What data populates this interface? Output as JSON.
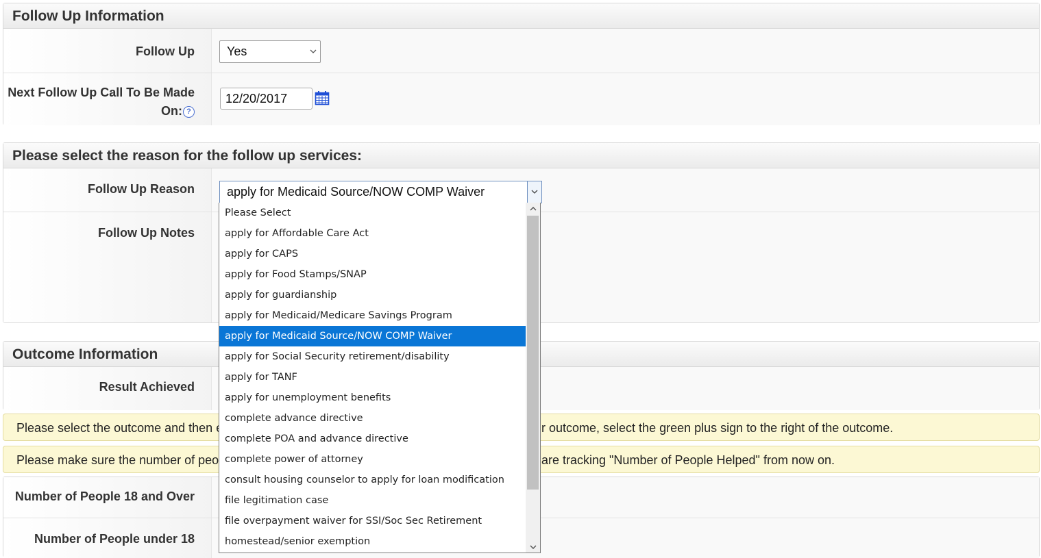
{
  "follow_up_panel": {
    "title": "Follow Up Information",
    "follow_up_label": "Follow Up",
    "follow_up_value": "Yes",
    "next_call_label": "Next Follow Up Call To Be Made On:",
    "next_call_value": "12/20/2017",
    "help_glyph": "?"
  },
  "reason_panel": {
    "title": "Please select the reason for the follow up services:",
    "reason_label": "Follow Up Reason",
    "reason_value": "apply for Medicaid Source/NOW COMP Waiver",
    "notes_label": "Follow Up Notes"
  },
  "outcome_panel": {
    "title": "Outcome Information",
    "result_label": "Result Achieved"
  },
  "notices": [
    {
      "left": "Please select the outcome and then er",
      "right": "r outcome, select the green plus sign to the right of the outcome."
    },
    {
      "left": "Please make sure the number of peop",
      "right": "are tracking \"Number of People Helped\" from now on."
    }
  ],
  "people_rows": [
    {
      "label": "Number of People 18 and Over"
    },
    {
      "label": "Number of People under 18"
    }
  ],
  "dropdown": {
    "selected": "apply for Medicaid Source/NOW COMP Waiver",
    "options": [
      "Please Select",
      "apply for Affordable Care Act",
      "apply for CAPS",
      "apply for Food Stamps/SNAP",
      "apply for guardianship",
      "apply for Medicaid/Medicare Savings Program",
      "apply for Medicaid Source/NOW COMP Waiver",
      "apply for Social Security retirement/disability",
      "apply for TANF",
      "apply for unemployment benefits",
      "complete advance directive",
      "complete POA and advance directive",
      "complete power of attorney",
      "consult housing counselor to apply for loan modification",
      "file legitimation case",
      "file overpayment waiver for SSI/Soc Sec Retirement",
      "homestead/senior exemption"
    ]
  },
  "icons": {
    "calendar": "calendar-icon",
    "help": "help-icon",
    "chevron": "chevron-down-icon"
  },
  "colors": {
    "selected_option": "#0a76d6",
    "notice_bg": "#fcf8d4",
    "calendar_icon": "#1f4fd6"
  }
}
